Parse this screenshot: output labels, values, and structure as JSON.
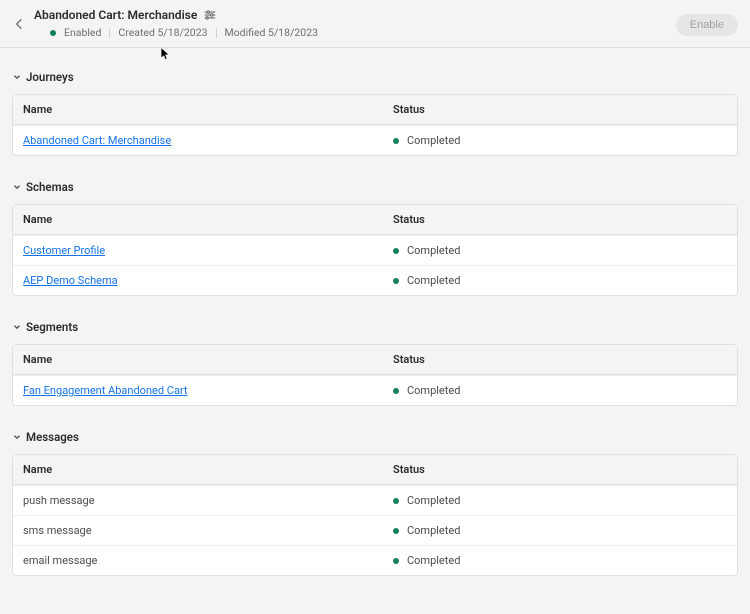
{
  "header": {
    "title": "Abandoned Cart: Merchandise",
    "enabled_label": "Enabled",
    "created_label": "Created 5/18/2023",
    "modified_label": "Modified 5/18/2023",
    "enable_button": "Enable"
  },
  "columns": {
    "name": "Name",
    "status": "Status"
  },
  "status_labels": {
    "completed": "Completed"
  },
  "sections": {
    "journeys": {
      "title": "Journeys",
      "rows": [
        {
          "name": "Abandoned Cart: Merchandise",
          "link": true
        }
      ]
    },
    "schemas": {
      "title": "Schemas",
      "rows": [
        {
          "name": "Customer Profile",
          "link": true
        },
        {
          "name": "AEP Demo Schema",
          "link": true
        }
      ]
    },
    "segments": {
      "title": "Segments",
      "rows": [
        {
          "name": "Fan Engagement Abandoned Cart",
          "link": true
        }
      ]
    },
    "messages": {
      "title": "Messages",
      "rows": [
        {
          "name": "push message",
          "link": false
        },
        {
          "name": "sms message",
          "link": false
        },
        {
          "name": "email message",
          "link": false
        }
      ]
    }
  },
  "colors": {
    "status_dot": "#12805c",
    "link": "#1473e6"
  }
}
